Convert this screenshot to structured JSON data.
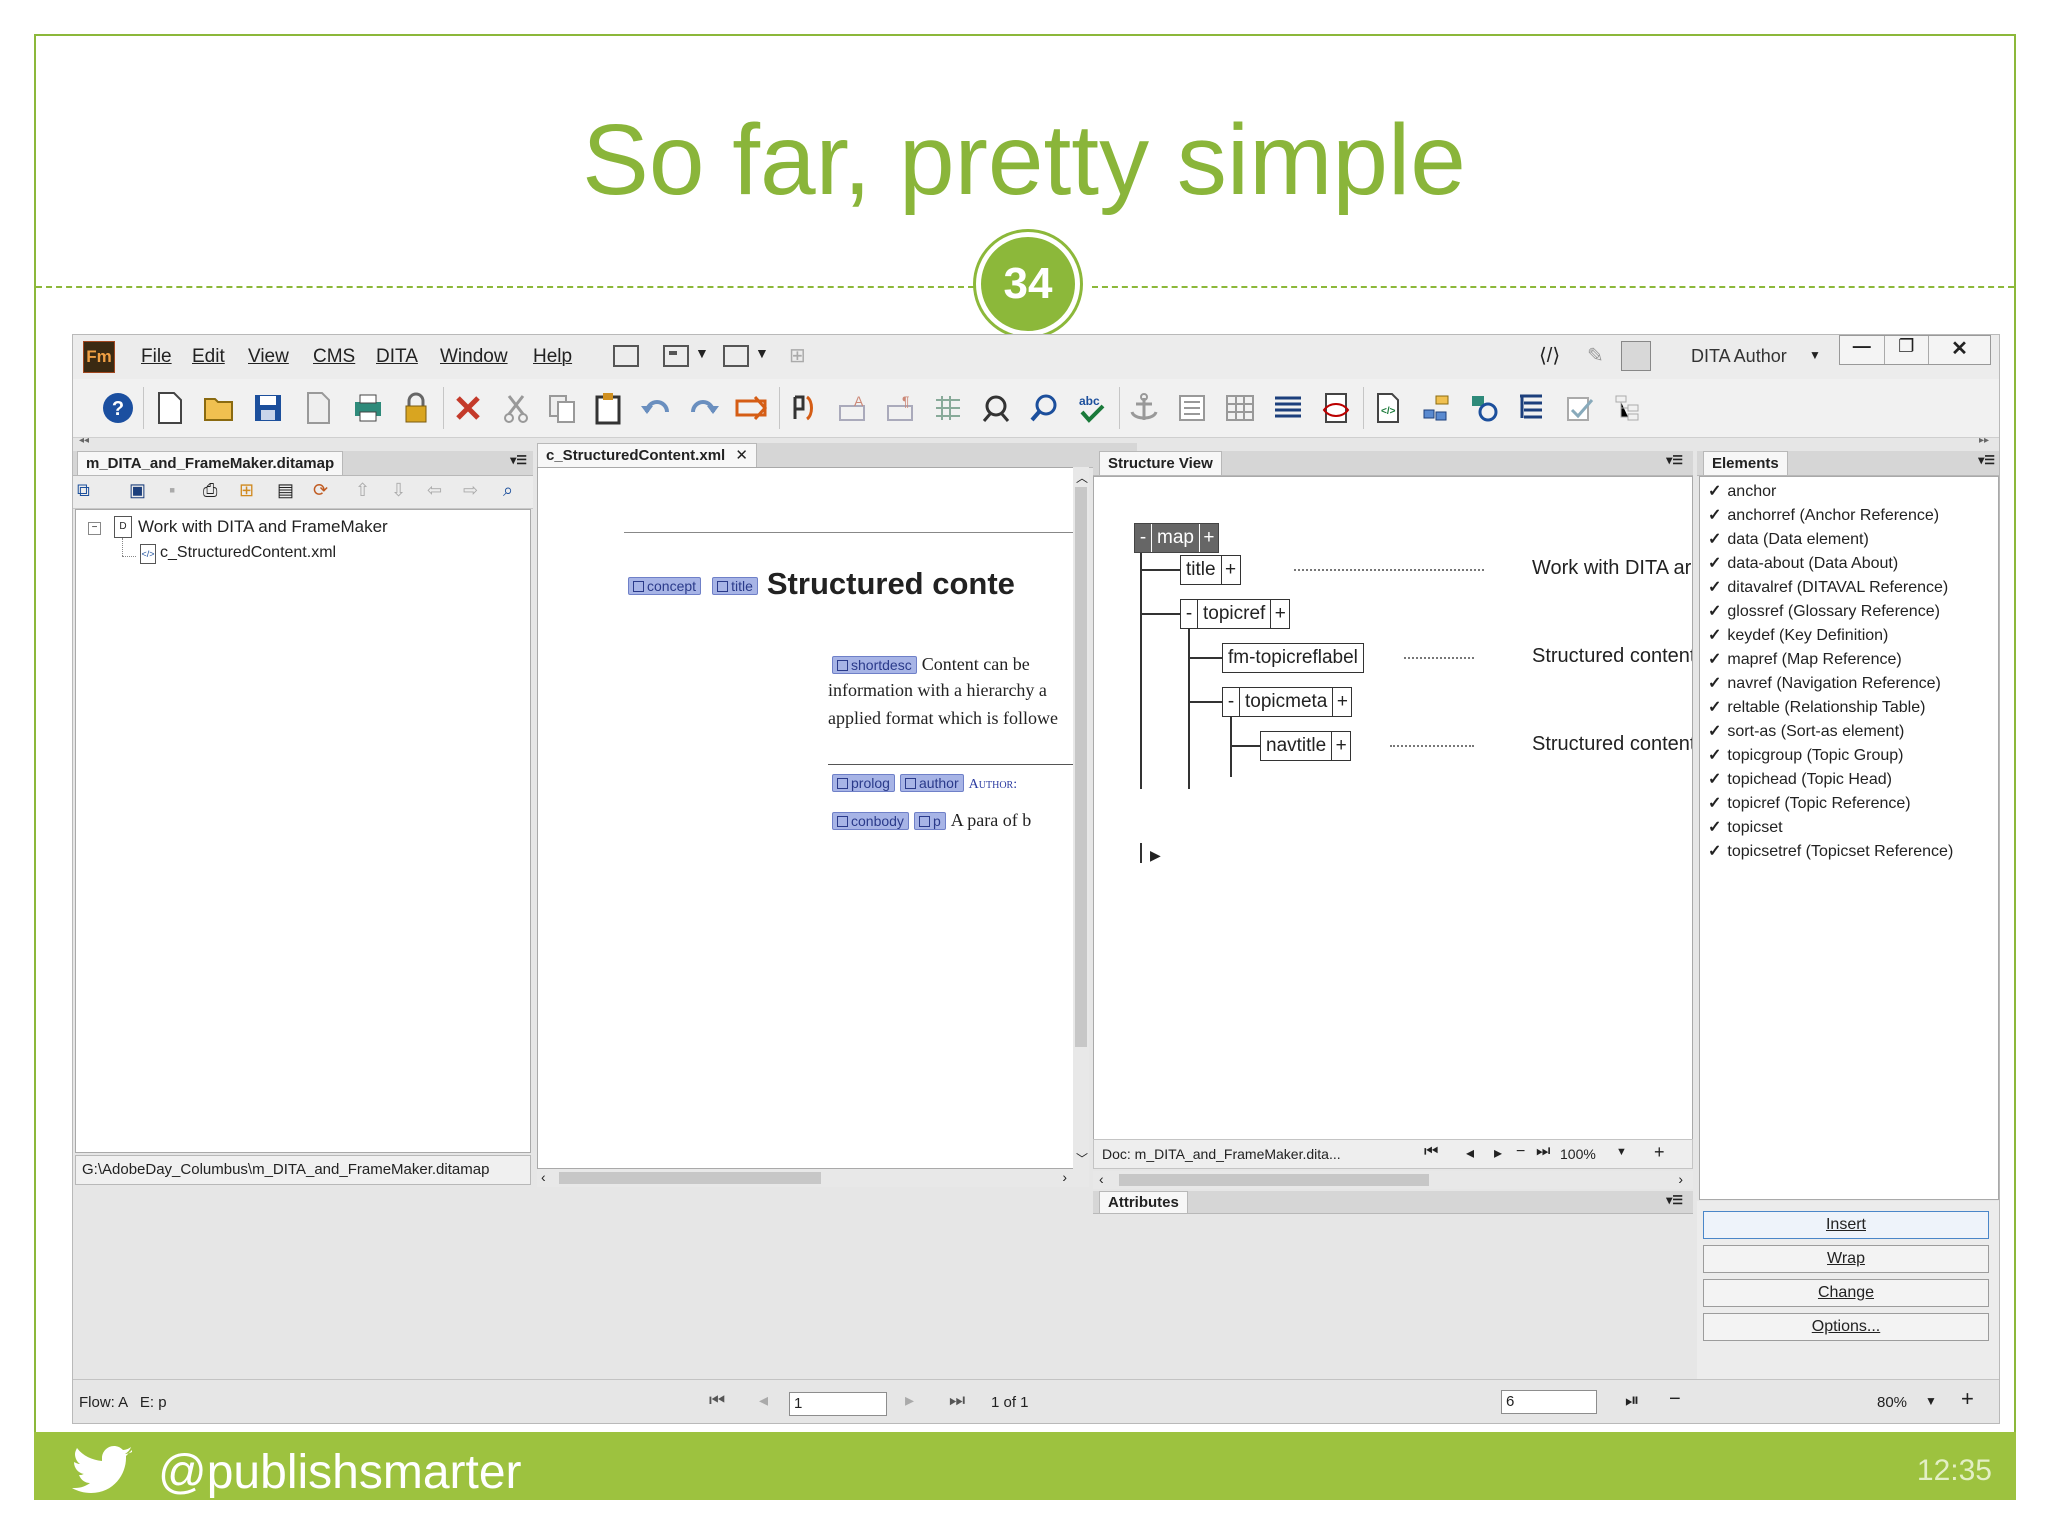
{
  "slide": {
    "title": "So far, pretty simple",
    "number": "34",
    "handle": "@publishsmarter",
    "time": "12:35",
    "accent_color": "#8cb83a",
    "footer_color": "#9dc23f"
  },
  "menubar": {
    "logo": "Fm",
    "items": [
      "File",
      "Edit",
      "View",
      "CMS",
      "DITA",
      "Window",
      "Help"
    ],
    "workspace": "DITA Author"
  },
  "toolbar": {
    "icons": [
      "help-icon",
      "new-document-icon",
      "open-folder-icon",
      "save-icon",
      "export-icon",
      "print-icon",
      "lock-icon",
      "delete-icon",
      "cut-icon",
      "copy-icon",
      "paste-icon",
      "undo-icon",
      "redo-icon",
      "move-icon",
      "spell-icon",
      "char-format-icon",
      "para-format-icon",
      "table-insert-icon",
      "find-icon",
      "zoom-find-icon",
      "spell-check-icon",
      "anchor-icon",
      "insert-table-icon",
      "table-icon",
      "align-icon",
      "pdf-icon",
      "xml-view-icon",
      "map-icon",
      "link-icon",
      "structure-icon",
      "validate-icon",
      "tree-icon"
    ]
  },
  "ditamap_panel": {
    "tab": "m_DITA_and_FrameMaker.ditamap",
    "root": "Work with DITA and FrameMaker",
    "child": "c_StructuredContent.xml",
    "path": "G:\\AdobeDay_Columbus\\m_DITA_and_FrameMaker.ditamap"
  },
  "doc_panel": {
    "tab": "c_StructuredContent.xml",
    "heading": "Structured conte",
    "tags": {
      "concept": "concept",
      "title": "title",
      "shortdesc": "shortdesc",
      "prolog": "prolog",
      "author": "author",
      "conbody": "conbody",
      "p": "p"
    },
    "shortdesc_line1": "Content can be",
    "shortdesc_line2": "information with a hierarchy a",
    "shortdesc_line3": "applied format which is followe",
    "author_text": "Author:",
    "para_text": "A para of b"
  },
  "structure_panel": {
    "tab": "Structure View",
    "nodes": {
      "map": "map",
      "title": "title",
      "topicref": "topicref",
      "fm_topicreflabel": "fm-topicreflabel",
      "topicmeta": "topicmeta",
      "navtitle": "navtitle"
    },
    "text_title": "Work with DITA ar",
    "text_label": "Structured content",
    "text_navtitle": "Structured content",
    "doc_label": "Doc: m_DITA_and_FrameMaker.dita...",
    "zoom": "100%",
    "attributes_tab": "Attributes"
  },
  "elements_panel": {
    "tab": "Elements",
    "items": [
      "anchor",
      "anchorref  (Anchor Reference)",
      "data  (Data element)",
      "data-about  (Data About)",
      "ditavalref  (DITAVAL Reference)",
      "glossref  (Glossary Reference)",
      "keydef  (Key Definition)",
      "mapref  (Map Reference)",
      "navref  (Navigation Reference)",
      "reltable  (Relationship Table)",
      "sort-as  (Sort-as element)",
      "topicgroup  (Topic Group)",
      "topichead  (Topic Head)",
      "topicref  (Topic Reference)",
      "topicset",
      "topicsetref  (Topicset Reference)"
    ],
    "buttons": [
      "Insert",
      "Wrap",
      "Change",
      "Options..."
    ]
  },
  "statusbar": {
    "flow": "Flow: A   E: p",
    "page_input": "1",
    "page_count": "1 of 1",
    "line_input": "6",
    "zoom": "80%"
  }
}
